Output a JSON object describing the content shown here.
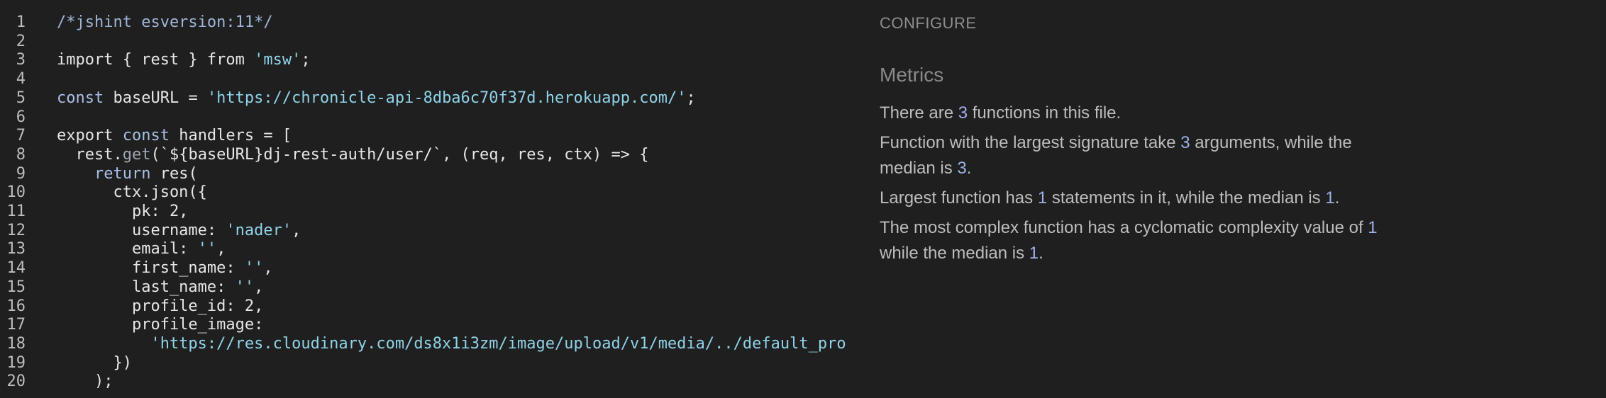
{
  "editor": {
    "lines": [
      {
        "n": "1",
        "tokens": [
          {
            "t": "/*jshint esversion:11*/",
            "c": "com"
          }
        ]
      },
      {
        "n": "2",
        "tokens": []
      },
      {
        "n": "3",
        "tokens": [
          {
            "t": "import { rest } from ",
            "c": "def"
          },
          {
            "t": "'msw'",
            "c": "str"
          },
          {
            "t": ";",
            "c": "def"
          }
        ]
      },
      {
        "n": "4",
        "tokens": []
      },
      {
        "n": "5",
        "tokens": [
          {
            "t": "const",
            "c": "kw"
          },
          {
            "t": " baseURL = ",
            "c": "def"
          },
          {
            "t": "'https://chronicle-api-8dba6c70f37d.herokuapp.com/'",
            "c": "str"
          },
          {
            "t": ";",
            "c": "def"
          }
        ]
      },
      {
        "n": "6",
        "tokens": []
      },
      {
        "n": "7",
        "tokens": [
          {
            "t": "export ",
            "c": "def"
          },
          {
            "t": "const",
            "c": "kw"
          },
          {
            "t": " handlers = [",
            "c": "def"
          }
        ]
      },
      {
        "n": "8",
        "tokens": [
          {
            "t": "  rest.",
            "c": "def"
          },
          {
            "t": "get",
            "c": "prop"
          },
          {
            "t": "(`${baseURL}dj-rest-auth/user/`, (req, res, ctx) => {",
            "c": "def"
          }
        ]
      },
      {
        "n": "9",
        "tokens": [
          {
            "t": "    ",
            "c": "def"
          },
          {
            "t": "return",
            "c": "kw"
          },
          {
            "t": " res(",
            "c": "def"
          }
        ]
      },
      {
        "n": "10",
        "tokens": [
          {
            "t": "      ctx.json({",
            "c": "def"
          }
        ]
      },
      {
        "n": "11",
        "tokens": [
          {
            "t": "        pk: 2,",
            "c": "def"
          }
        ]
      },
      {
        "n": "12",
        "tokens": [
          {
            "t": "        username: ",
            "c": "def"
          },
          {
            "t": "'nader'",
            "c": "str"
          },
          {
            "t": ",",
            "c": "def"
          }
        ]
      },
      {
        "n": "13",
        "tokens": [
          {
            "t": "        email: ",
            "c": "def"
          },
          {
            "t": "''",
            "c": "str"
          },
          {
            "t": ",",
            "c": "def"
          }
        ]
      },
      {
        "n": "14",
        "tokens": [
          {
            "t": "        first_name: ",
            "c": "def"
          },
          {
            "t": "''",
            "c": "str"
          },
          {
            "t": ",",
            "c": "def"
          }
        ]
      },
      {
        "n": "15",
        "tokens": [
          {
            "t": "        last_name: ",
            "c": "def"
          },
          {
            "t": "''",
            "c": "str"
          },
          {
            "t": ",",
            "c": "def"
          }
        ]
      },
      {
        "n": "16",
        "tokens": [
          {
            "t": "        profile_id: 2,",
            "c": "def"
          }
        ]
      },
      {
        "n": "17",
        "tokens": [
          {
            "t": "        profile_image:",
            "c": "def"
          }
        ]
      },
      {
        "n": "18",
        "tokens": [
          {
            "t": "          ",
            "c": "def"
          },
          {
            "t": "'https://res.cloudinary.com/ds8x1i3zm/image/upload/v1/media/../default_pro",
            "c": "str"
          }
        ]
      },
      {
        "n": "19",
        "tokens": [
          {
            "t": "      })",
            "c": "def"
          }
        ]
      },
      {
        "n": "20",
        "tokens": [
          {
            "t": "    );",
            "c": "def"
          }
        ]
      }
    ]
  },
  "panel": {
    "configure": "CONFIGURE",
    "metrics_title": "Metrics",
    "paragraphs": [
      [
        {
          "t": "There are "
        },
        {
          "t": "3",
          "num": true
        },
        {
          "t": " functions in this file."
        }
      ],
      [
        {
          "t": "Function with the largest signature take "
        },
        {
          "t": "3",
          "num": true
        },
        {
          "t": " arguments, while the median is "
        },
        {
          "t": "3",
          "num": true
        },
        {
          "t": "."
        }
      ],
      [
        {
          "t": "Largest function has "
        },
        {
          "t": "1",
          "num": true
        },
        {
          "t": " statements in it, while the median is "
        },
        {
          "t": "1",
          "num": true
        },
        {
          "t": "."
        }
      ],
      [
        {
          "t": "The most complex function has a cyclomatic complexity value of "
        },
        {
          "t": "1",
          "num": true
        },
        {
          "t": " while the median is "
        },
        {
          "t": "1",
          "num": true
        },
        {
          "t": "."
        }
      ]
    ]
  },
  "colors": {
    "background": "#1f1f1f",
    "number_accent": "#9fb0e8",
    "string": "#8fd3e8",
    "comment": "#9fb4d8"
  }
}
